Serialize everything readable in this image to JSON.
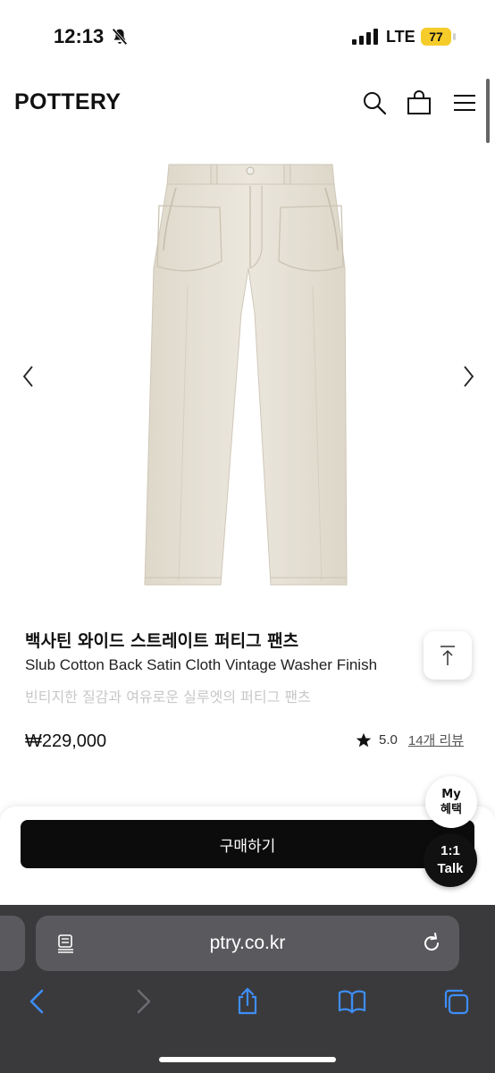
{
  "status_bar": {
    "time": "12:13",
    "network": "LTE",
    "battery": "77"
  },
  "header": {
    "logo": "POTTERY"
  },
  "product": {
    "title_ko": "백사틴 와이드 스트레이트 퍼티그 팬츠",
    "title_en": "Slub Cotton Back Satin Cloth Vintage Washer Finish",
    "subtitle": "빈티지한 질감과 여유로운 실루엣의 퍼티그 팬츠",
    "price": "₩229,000",
    "rating": "5.0",
    "review_link": "14개 리뷰",
    "image_color": "#e7e2d6"
  },
  "purchase": {
    "buy_label": "구매하기"
  },
  "floating": {
    "my_line1": "My",
    "my_line2": "혜택",
    "talk_line1": "1:1",
    "talk_line2": "Talk"
  },
  "browser": {
    "url": "ptry.co.kr"
  },
  "colors": {
    "accent_black": "#0c0c0c",
    "battery_yellow": "#f5cc2a",
    "safari_blue": "#3e8ef7"
  }
}
